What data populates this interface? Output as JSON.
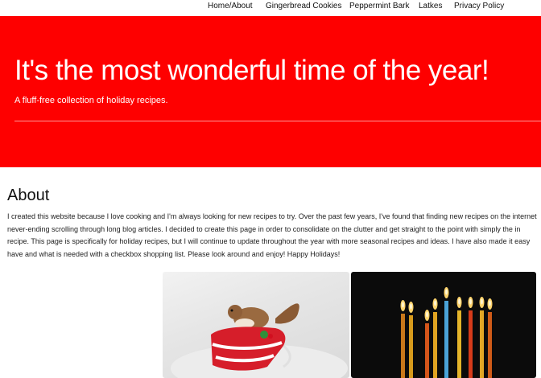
{
  "nav": {
    "items": [
      "Home/About",
      "Gingerbread Cookies",
      "Peppermint Bark",
      "Latkes",
      "Privacy Policy"
    ]
  },
  "hero": {
    "title": "It's the most wonderful time of the year!",
    "subtitle": "A fluff-free collection of holiday recipes."
  },
  "about": {
    "heading": "About",
    "lines": [
      "I created this website because I love cooking and I'm always looking for new recipes to try. Over the past few years, I've found that finding new recipes on the internet",
      "never-ending scrolling through long blog articles. I decided to create this page in order to consolidate on the clutter and get straight to the point with simply the in",
      "recipe. This page is specifically for holiday recipes, but I will continue to update throughout the year with more seasonal recipes and ideas. I have also made it easy",
      "have and what is needed with a checkbox shopping list. Please look around and enjoy! Happy Holidays!"
    ]
  },
  "photos": [
    {
      "name": "squirrel-photo"
    },
    {
      "name": "menorah-candles-photo"
    }
  ],
  "colors": {
    "hero_bg": "#fe0000",
    "hero_text": "#ffffff",
    "page_bg": "#ffffff"
  }
}
